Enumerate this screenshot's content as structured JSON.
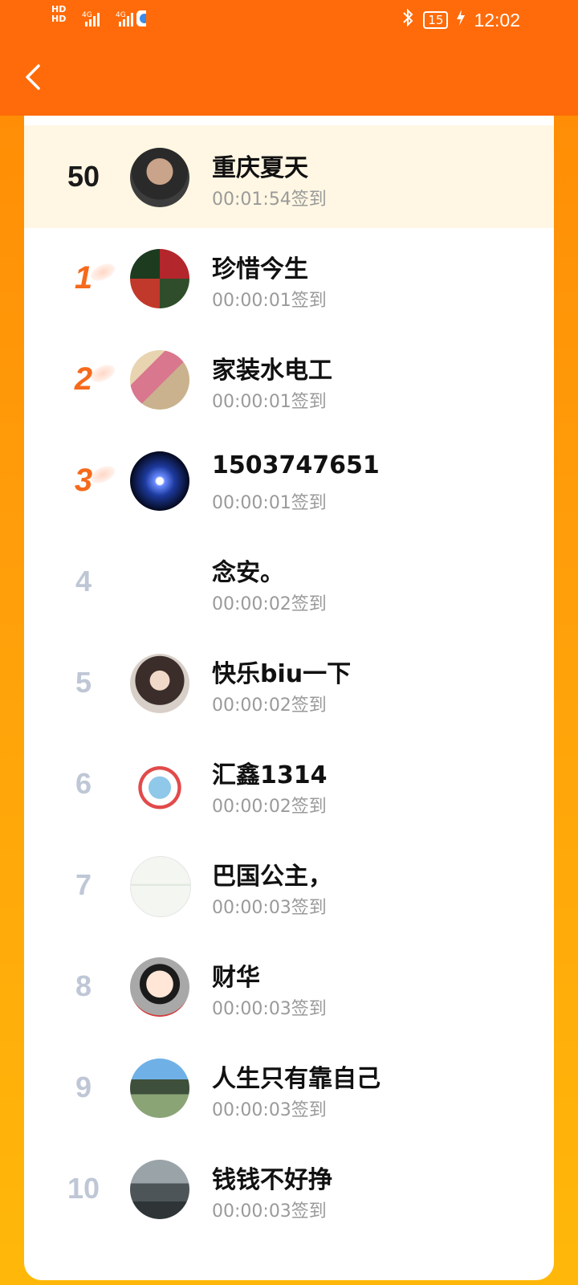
{
  "status_bar": {
    "hd1": "HD",
    "hd2": "HD",
    "signal1": "4G",
    "signal2": "4G",
    "battery": "15",
    "time": "12:02",
    "icons": [
      "bluetooth-icon",
      "battery-icon",
      "charging-icon",
      "browser-notification-icon"
    ]
  },
  "header": {
    "back_icon": "chevron-left-icon"
  },
  "colors": {
    "accent": "#FF6B0A",
    "medal": "#F56A1C",
    "rank_gray": "#BFC7D6",
    "self_bg": "#FFF7E3"
  },
  "self": {
    "rank": "50",
    "name": "重庆夏天",
    "time": "00:01:54签到"
  },
  "list": [
    {
      "rank": "1",
      "name": "珍惜今生",
      "time": "00:00:01签到"
    },
    {
      "rank": "2",
      "name": "家装水电工",
      "time": "00:00:01签到"
    },
    {
      "rank": "3",
      "name": "1503747651",
      "time": "00:00:01签到"
    },
    {
      "rank": "4",
      "name": "念安。",
      "time": "00:00:02签到"
    },
    {
      "rank": "5",
      "name": "快乐biu一下",
      "time": "00:00:02签到"
    },
    {
      "rank": "6",
      "name": "汇鑫1314",
      "time": "00:00:02签到"
    },
    {
      "rank": "7",
      "name": "巴国公主，",
      "time": "00:00:03签到"
    },
    {
      "rank": "8",
      "name": "财华",
      "time": "00:00:03签到"
    },
    {
      "rank": "9",
      "name": "人生只有靠自己",
      "time": "00:00:03签到"
    },
    {
      "rank": "10",
      "name": "钱钱不好挣",
      "time": "00:00:03签到"
    }
  ]
}
